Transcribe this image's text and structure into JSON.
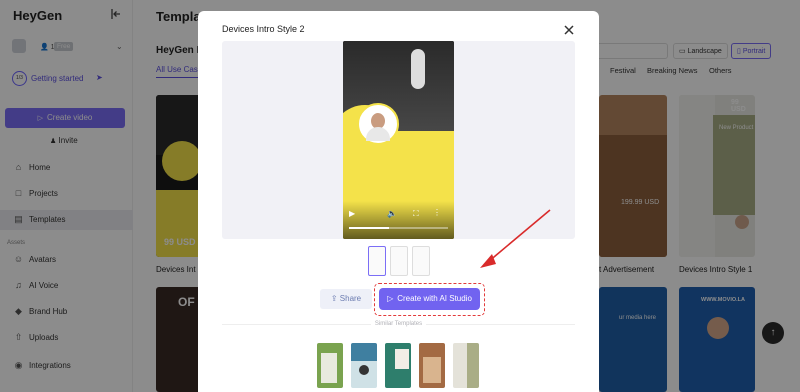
{
  "app": {
    "logo": "HeyGen"
  },
  "sidebar": {
    "workspace": {
      "users": "1",
      "plan": "Free"
    },
    "onboarding": {
      "progress": "1/3",
      "label": "Getting started"
    },
    "create_video": "Create video",
    "invite": "Invite",
    "nav_top": [
      {
        "label": "Home",
        "icon": "home-icon"
      },
      {
        "label": "Projects",
        "icon": "folder-icon"
      },
      {
        "label": "Templates",
        "icon": "templates-icon"
      }
    ],
    "section_assets": "Assets",
    "nav_assets": [
      {
        "label": "Avatars",
        "icon": "avatar-icon"
      },
      {
        "label": "AI Voice",
        "icon": "voice-icon"
      },
      {
        "label": "Brand Hub",
        "icon": "brand-icon"
      },
      {
        "label": "Uploads",
        "icon": "upload-icon"
      },
      {
        "label": "Integrations",
        "icon": "integrations-icon"
      }
    ]
  },
  "main": {
    "title": "Templates",
    "subtitle": "HeyGen L",
    "tab_active": "All Use Case",
    "search_placeholder": "es",
    "orientation": {
      "landscape": "Landscape",
      "portrait": "Portrait"
    },
    "categories": [
      "Festival",
      "Breaking News",
      "Others"
    ],
    "cards": {
      "left": {
        "label": "Devices Int",
        "price": "99 USD"
      },
      "right1": {
        "label": "t Advertisement",
        "price": "199.99 USD"
      },
      "right2": {
        "label": "Devices Intro Style 1",
        "price": "99 USD",
        "heading": "New Product"
      },
      "bottom_left": {
        "text": "OF"
      },
      "bottom_mid": {
        "text": "ur media here"
      },
      "bottom_right": {
        "text": "WWW.MOVIO.LA"
      }
    }
  },
  "modal": {
    "title": "Devices Intro Style 2",
    "share": "Share",
    "create_studio": "Create with AI Studio",
    "similar": "Similar Templates"
  },
  "colors": {
    "accent": "#7163f0",
    "highlight": "#e33a3a",
    "video_yellow": "#f4e24a"
  }
}
